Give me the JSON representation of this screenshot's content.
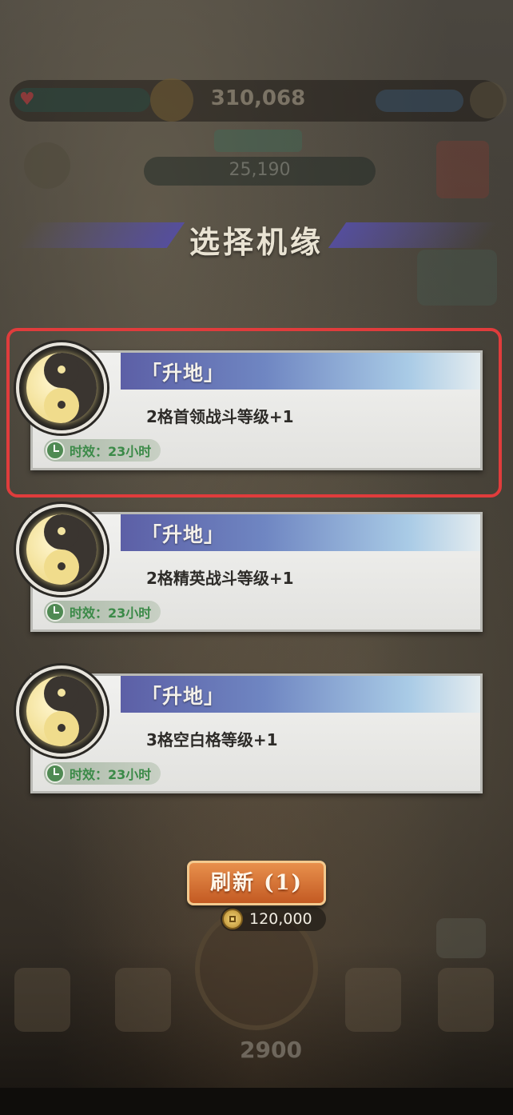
{
  "header": {
    "title": "选择机缘",
    "score": "310,068",
    "sub_value": "25,190"
  },
  "cards": [
    {
      "name": "「升地」",
      "desc": "2格首领战斗等级+1",
      "timer": "时效：23小时",
      "highlighted": true
    },
    {
      "name": "「升地」",
      "desc": "2格精英战斗等级+1",
      "timer": "时效：23小时",
      "highlighted": false
    },
    {
      "name": "「升地」",
      "desc": "3格空白格等级+1",
      "timer": "时效：23小时",
      "highlighted": false
    }
  ],
  "refresh": {
    "label": "刷新 (1)",
    "cost": "120,000"
  },
  "bottom": {
    "center_value": "2900"
  },
  "colors": {
    "highlight": "#e03c3c",
    "card_header_start": "#5c5fa6",
    "refresh_button": "#d8763a",
    "timer_text": "#3b8a48"
  },
  "icons": {
    "card_emblem": "yin-yang-icon",
    "timer": "clock-icon",
    "currency": "coin-icon"
  }
}
